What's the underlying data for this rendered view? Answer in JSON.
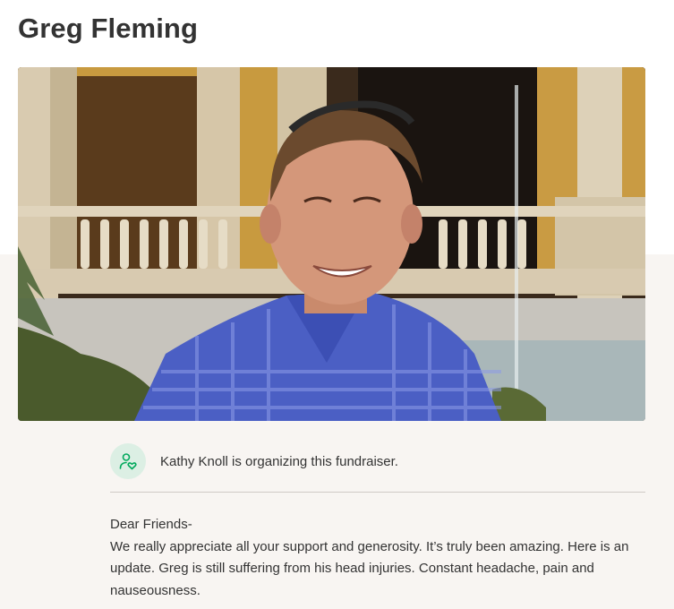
{
  "campaign": {
    "title": "Greg Fleming",
    "hero_image": "portrait-smiling-man-blue-plaid-shirt-courtyard-fountain"
  },
  "organizer": {
    "icon": "heart-person-icon",
    "text": "Kathy Knoll is organizing this fundraiser."
  },
  "story": {
    "greeting": "Dear Friends-",
    "body": "We really appreciate all your support and generosity. It’s truly been amazing.  Here is an update. Greg is still suffering from his head injuries.  Constant headache, pain and nauseousness."
  },
  "colors": {
    "icon_bg": "#dcefe4",
    "icon_stroke": "#02a95c",
    "page_bg_lower": "#f8f5f2",
    "divider": "#cfcac5"
  }
}
